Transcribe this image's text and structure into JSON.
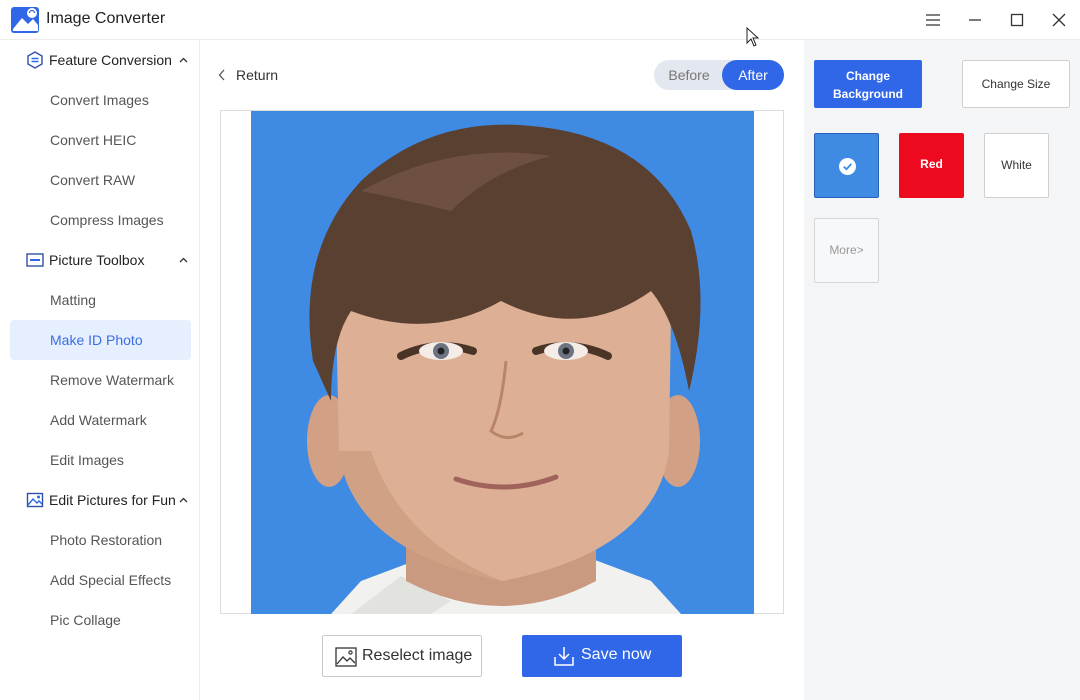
{
  "app": {
    "title": "Image Converter"
  },
  "sidebar": {
    "groups": [
      {
        "label": "Feature Conversion",
        "items": [
          "Convert Images",
          "Convert HEIC",
          "Convert RAW",
          "Compress Images"
        ]
      },
      {
        "label": "Picture Toolbox",
        "items": [
          "Matting",
          "Make ID Photo",
          "Remove Watermark",
          "Add Watermark",
          "Edit Images"
        ]
      },
      {
        "label": "Edit Pictures for Fun",
        "items": [
          "Photo Restoration",
          "Add Special Effects",
          "Pic Collage"
        ]
      }
    ],
    "active_item": "Make ID Photo"
  },
  "main": {
    "return_label": "Return",
    "toggle": {
      "before": "Before",
      "after": "After",
      "selected": "After"
    },
    "reselect_label": "Reselect image",
    "save_label": "Save now",
    "photo_background": "#3f8ae2"
  },
  "panel": {
    "change_background_label": "Change Background",
    "change_size_label": "Change Size",
    "swatches": [
      {
        "label": "",
        "color": "#3f8ae2",
        "selected": true
      },
      {
        "label": "Red",
        "color": "#ee0a1e",
        "selected": false
      },
      {
        "label": "White",
        "color": "#ffffff",
        "selected": false
      }
    ],
    "more_label": "More>"
  },
  "colors": {
    "accent": "#2f67e8",
    "active_bg": "#e6effd"
  }
}
